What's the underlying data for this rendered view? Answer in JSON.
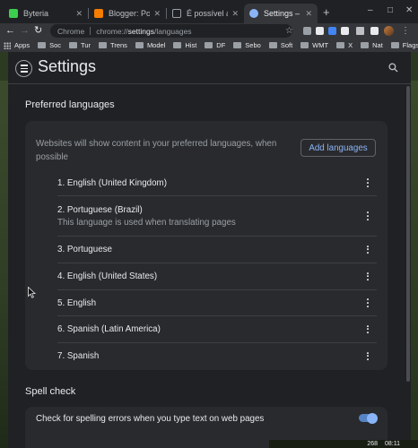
{
  "tabs": [
    {
      "title": "Byteria",
      "favicon_color": "#3ccf4e"
    },
    {
      "title": "Blogger: Posts",
      "favicon_color": "#f57d00"
    },
    {
      "title": "É possível alterar",
      "favicon_color": "#202124"
    },
    {
      "title": "Settings – Langua",
      "favicon_color": "#8ab4f8"
    }
  ],
  "toolbar": {
    "site_chip": "Chrome",
    "url_host": "chrome://",
    "url_bold": "settings",
    "url_path": "/languages"
  },
  "bookmarks": [
    "Apps",
    "Soc",
    "Tur",
    "Trens",
    "Model",
    "Hist",
    "DF",
    "Sebo",
    "Soft",
    "WMT",
    "X",
    "Nat",
    "Flags"
  ],
  "header": {
    "title": "Settings"
  },
  "preferred": {
    "section_title": "Preferred languages",
    "description": "Websites will show content in your preferred languages, when possible",
    "add_button": "Add languages",
    "languages": [
      {
        "name": "1. English (United Kingdom)"
      },
      {
        "name": "2. Portuguese (Brazil)",
        "note": "This language is used when translating pages"
      },
      {
        "name": "3. Portuguese"
      },
      {
        "name": "4. English (United States)"
      },
      {
        "name": "5. English"
      },
      {
        "name": "6. Spanish (Latin America)"
      },
      {
        "name": "7. Spanish"
      }
    ]
  },
  "spell": {
    "section_title": "Spell check",
    "check_label": "Check for spelling errors when you type text on web pages",
    "enabled": true
  },
  "taskbar": {
    "time": "08:11",
    "volume": "268"
  },
  "colors": {
    "accent": "#8ab4f8",
    "page_bg": "#202124",
    "card_bg": "#292a2d"
  }
}
